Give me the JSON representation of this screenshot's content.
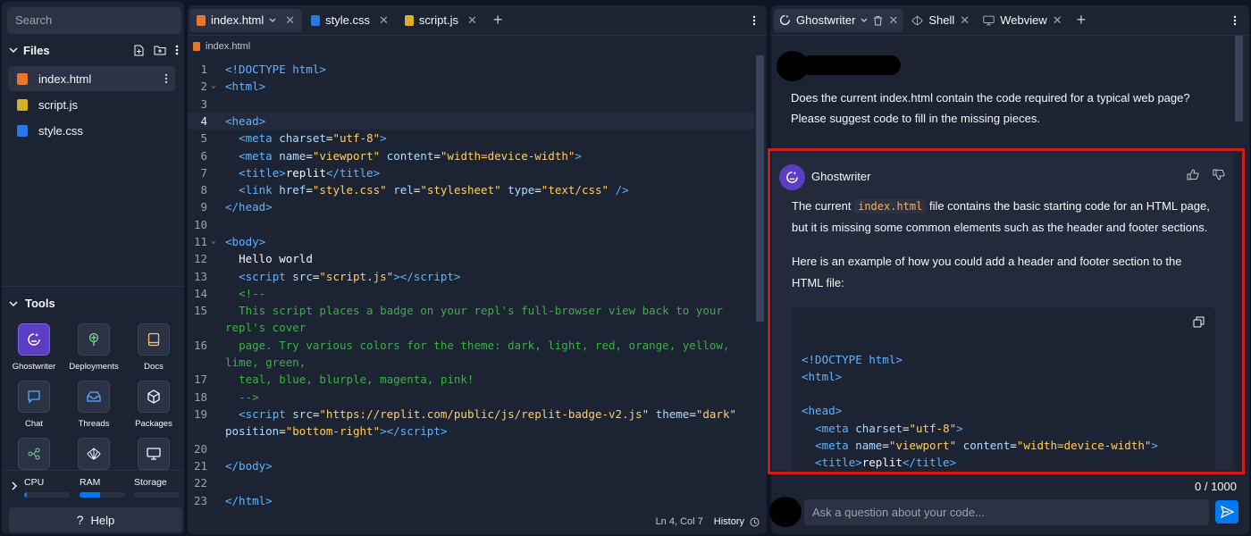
{
  "sidebar": {
    "search_placeholder": "Search",
    "files_title": "Files",
    "files": [
      {
        "name": "index.html",
        "color": "#e8772e"
      },
      {
        "name": "script.js",
        "color": "#d4b125"
      },
      {
        "name": "style.css",
        "color": "#2b77e3"
      }
    ],
    "tools_title": "Tools",
    "tools": [
      "Ghostwriter",
      "Deployments",
      "Docs",
      "Chat",
      "Threads",
      "Packages"
    ],
    "resources": {
      "cpu_label": "CPU",
      "ram_label": "RAM",
      "storage_label": "Storage",
      "cpu_usage": 0.05,
      "ram_usage": 0.45,
      "storage_usage": 0.0
    },
    "help_label": "Help"
  },
  "editor": {
    "tabs": [
      {
        "label": "index.html",
        "color": "#e8772e"
      },
      {
        "label": "style.css",
        "color": "#2b77e3"
      },
      {
        "label": "script.js",
        "color": "#d4b125"
      }
    ],
    "breadcrumb": "index.html",
    "lines": [
      {
        "n": "1",
        "html": "<span class=\"tg\">&lt;!DOCTYPE html&gt;</span>"
      },
      {
        "n": "2",
        "html": "<span class=\"tg\">&lt;html&gt;</span>"
      },
      {
        "n": "3",
        "html": ""
      },
      {
        "n": "4",
        "html": "<span class=\"tg\">&lt;head&gt;</span>"
      },
      {
        "n": "5",
        "html": "  <span class=\"tg\">&lt;meta</span> <span class=\"at\">charset</span>=<span class=\"str\">\"utf-8\"</span><span class=\"tg\">&gt;</span>"
      },
      {
        "n": "6",
        "html": "  <span class=\"tg\">&lt;meta</span> <span class=\"at\">name</span>=<span class=\"str\">\"viewport\"</span> <span class=\"at\">content</span>=<span class=\"str\">\"width=device-width\"</span><span class=\"tg\">&gt;</span>"
      },
      {
        "n": "7",
        "html": "  <span class=\"tg\">&lt;title&gt;</span>replit<span class=\"tg\">&lt;/title&gt;</span>"
      },
      {
        "n": "8",
        "html": "  <span class=\"tg\">&lt;link</span> <span class=\"at\">href</span>=<span class=\"str\">\"style.css\"</span> <span class=\"at\">rel</span>=<span class=\"str\">\"stylesheet\"</span> <span class=\"at\">type</span>=<span class=\"str\">\"text/css\"</span> <span class=\"tg\">/&gt;</span>"
      },
      {
        "n": "9",
        "html": "<span class=\"tg\">&lt;/head&gt;</span>"
      },
      {
        "n": "10",
        "html": ""
      },
      {
        "n": "11",
        "html": "<span class=\"tg\">&lt;body&gt;</span>"
      },
      {
        "n": "12",
        "html": "  Hello world"
      },
      {
        "n": "13",
        "html": "  <span class=\"tg\">&lt;script</span> <span class=\"at\">src</span>=<span class=\"str\">\"script.js\"</span><span class=\"tg\">&gt;&lt;/script&gt;</span>"
      },
      {
        "n": "14",
        "html": "  <span class=\"cm\">&lt;!--</span>"
      },
      {
        "n": "15",
        "html": "  <span class=\"cm\">This script places a badge on your repl's full-browser view back to your repl's cover</span>"
      },
      {
        "n": "16",
        "html": "  <span class=\"cm\">page. Try various colors for the theme: dark, light, red, orange, yellow, lime, green,</span>"
      },
      {
        "n": "17",
        "html": "  <span class=\"cm\">teal, blue, blurple, magenta, pink!</span>"
      },
      {
        "n": "18",
        "html": "  <span class=\"cm\">--&gt;</span>"
      },
      {
        "n": "19",
        "html": "  <span class=\"tg\">&lt;script</span> <span class=\"at\">src</span>=<span class=\"str\">\"https://replit.com/public/js/replit-badge-v2.js\"</span> <span class=\"at\">theme</span>=<span class=\"str\">\"dark\"</span> <span class=\"at\">position</span>=<span class=\"str\">\"bottom-right\"</span><span class=\"tg\">&gt;&lt;/script&gt;</span>"
      },
      {
        "n": "20",
        "html": ""
      },
      {
        "n": "21",
        "html": "<span class=\"tg\">&lt;/body&gt;</span>"
      },
      {
        "n": "22",
        "html": ""
      },
      {
        "n": "23",
        "html": "<span class=\"tg\">&lt;/html&gt;</span>"
      }
    ],
    "status_position": "Ln 4, Col 7",
    "history_label": "History"
  },
  "assistant": {
    "tabs": [
      "Ghostwriter",
      "Shell",
      "Webview"
    ],
    "user_message": "Does the current index.html contain the code required for a typical web page? Please suggest code to fill in the missing pieces.",
    "reply_author": "Ghostwriter",
    "reply_p1_before": "The current ",
    "reply_p1_code": "index.html",
    "reply_p1_after": " file contains the basic starting code for an HTML page, but it is missing some common elements such as the header and footer sections.",
    "reply_p2": "Here is an example of how you could add a header and footer section to the HTML file:",
    "code_html": "<span class=\"tg\">&lt;!DOCTYPE html&gt;</span>\n<span class=\"tg\">&lt;html&gt;</span>\n\n<span class=\"tg\">&lt;head&gt;</span>\n  <span class=\"tg\">&lt;meta</span> <span class=\"at\">charset</span>=<span class=\"str\">\"utf-8\"</span><span class=\"tg\">&gt;</span>\n  <span class=\"tg\">&lt;meta</span> <span class=\"at\">name</span>=<span class=\"str\">\"viewport\"</span> <span class=\"at\">content</span>=<span class=\"str\">\"width=device-width\"</span><span class=\"tg\">&gt;</span>\n  <span class=\"tg\">&lt;title&gt;</span>replit<span class=\"tg\">&lt;/title&gt;</span>\n  <span class=\"tg\">&lt;link</span> <span class=\"at\">href</span>=<span class=\"str\">\"style.css\"</span> <span class=\"at\">rel</span>=<span class=\"str\">\"stylesheet\"</span> <span class=\"at\">type</span>=<span class=\"str\">\"text/css\"</span>\n<span class=\"tg\">/&gt;</span>",
    "char_count": "0 / 1000",
    "input_placeholder": "Ask a question about your code..."
  }
}
